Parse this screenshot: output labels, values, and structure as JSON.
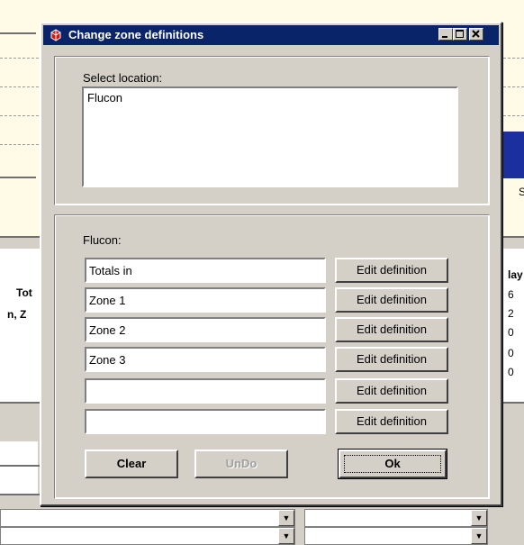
{
  "dialog": {
    "title": "Change zone definitions",
    "select_location_label": "Select location:",
    "locations": [
      "Flucon"
    ],
    "zones_group_label": "Flucon:",
    "zones": [
      "Totals in",
      "Zone 1",
      "Zone 2",
      "Zone 3",
      "",
      ""
    ],
    "edit_button_label": "Edit definition",
    "clear_label": "Clear",
    "undo_label": "UnDo",
    "ok_label": "Ok"
  },
  "background": {
    "col_text_1": "Tot",
    "col_text_2": "n, Z",
    "col_header_right": "lay",
    "right_values": [
      "6",
      "2",
      "0",
      "0",
      "0"
    ],
    "right_label_s": "S"
  },
  "icons": {
    "app": "app-icon",
    "minimize": "minimize-icon",
    "maximize": "maximize-icon",
    "close": "close-icon",
    "dropdown": "dropdown-arrow-icon"
  },
  "colors": {
    "titlebar": "#0a246a",
    "face": "#d4d0c8",
    "background_panel": "#fffbe6"
  }
}
